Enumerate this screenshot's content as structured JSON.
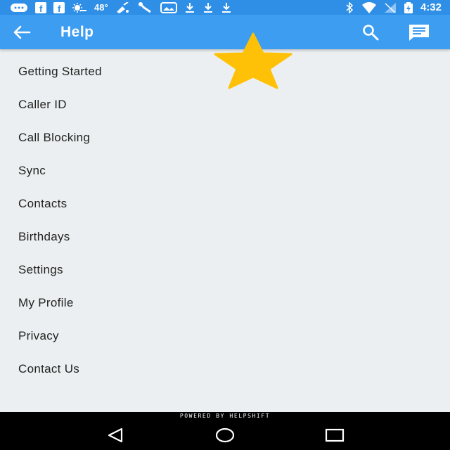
{
  "status_bar": {
    "temperature": "48°",
    "time": "4:32",
    "icons_left": [
      "messages-icon",
      "facebook-icon",
      "facebook-icon",
      "weather-icon",
      "temperature-text",
      "sweeper-icon",
      "wrench-icon",
      "gallery-icon",
      "download-icon",
      "download-icon",
      "download-icon"
    ],
    "icons_right": [
      "bluetooth-icon",
      "wifi-icon",
      "no-sim-icon",
      "battery-charging-icon",
      "clock-text"
    ]
  },
  "app_bar": {
    "title": "Help",
    "back_icon": "arrow-left-icon",
    "search_icon": "search-icon",
    "chat_icon": "chat-icon",
    "color": "#3d9df0"
  },
  "overlay": {
    "icon": "star-icon",
    "color": "#ffc107"
  },
  "topics": [
    {
      "label": "Getting Started"
    },
    {
      "label": "Caller ID"
    },
    {
      "label": "Call Blocking"
    },
    {
      "label": "Sync"
    },
    {
      "label": "Contacts"
    },
    {
      "label": "Birthdays"
    },
    {
      "label": "Settings"
    },
    {
      "label": "My Profile"
    },
    {
      "label": "Privacy"
    },
    {
      "label": "Contact Us"
    }
  ],
  "footer": {
    "powered_by": "POWERED BY HELPSHIFT"
  },
  "nav_bar": {
    "back_icon": "nav-back-icon",
    "home_icon": "nav-home-icon",
    "recents_icon": "nav-recents-icon"
  }
}
